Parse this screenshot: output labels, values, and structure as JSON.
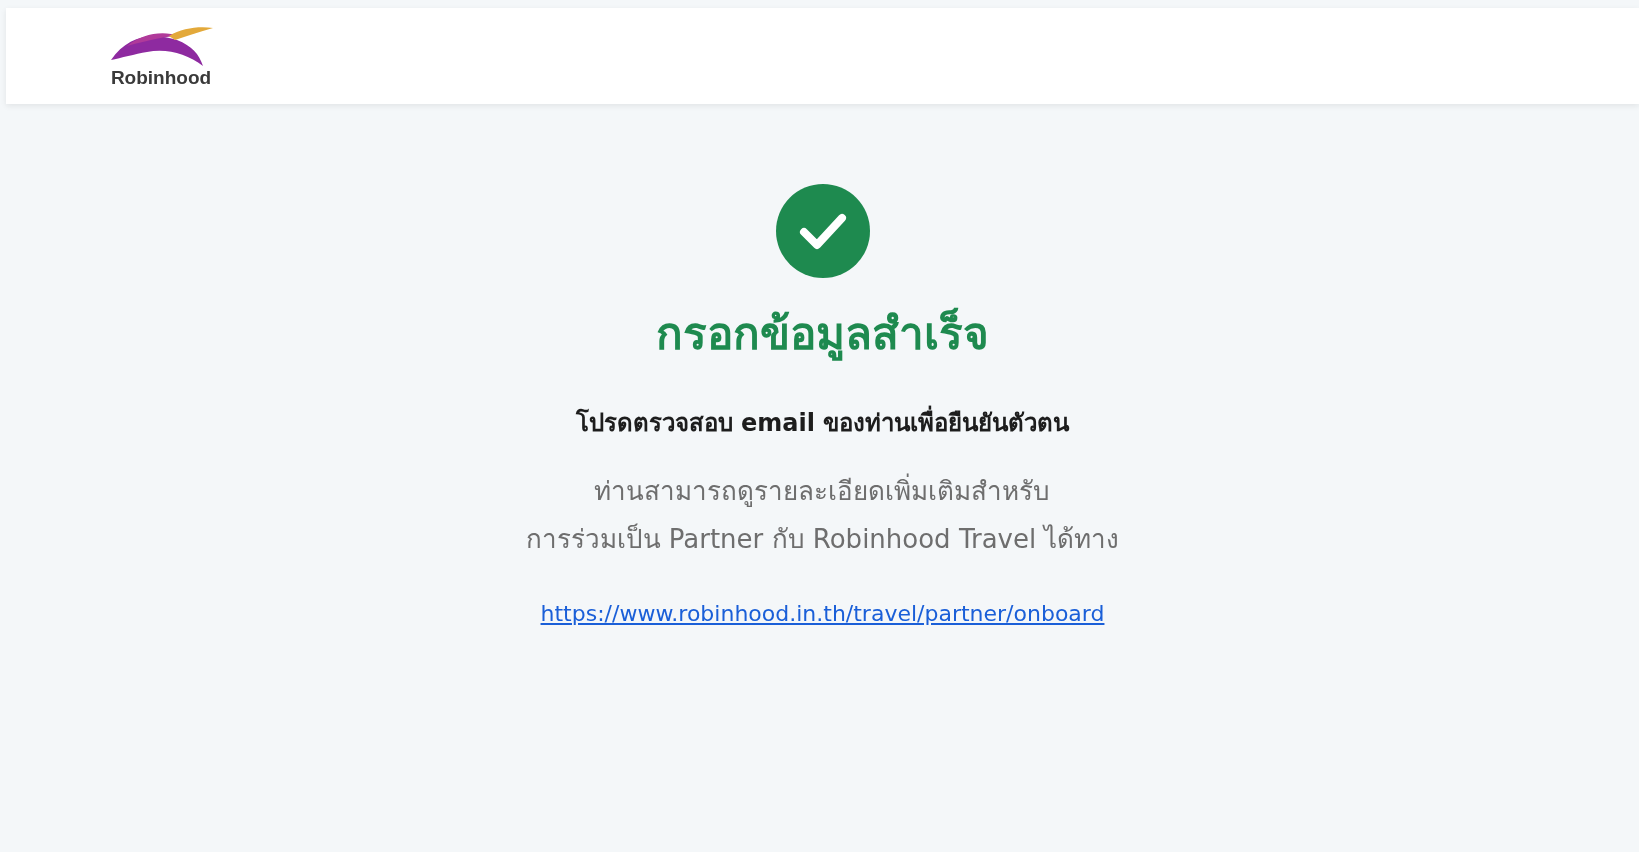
{
  "header": {
    "logo_text": "Robinhood"
  },
  "result": {
    "success": true,
    "title": "กรอกข้อมูลสำเร็จ",
    "subtitle": "โปรดตรวจสอบ email ของท่านเพื่อยืนยันตัวตน",
    "description_lines": [
      "ท่านสามารถดูรายละเอียดเพิ่มเติมสำหรับ",
      "การร่วมเป็น Partner กับ Robinhood Travel ได้ทาง"
    ],
    "link": "https://www.robinhood.in.th/travel/partner/onboard"
  }
}
